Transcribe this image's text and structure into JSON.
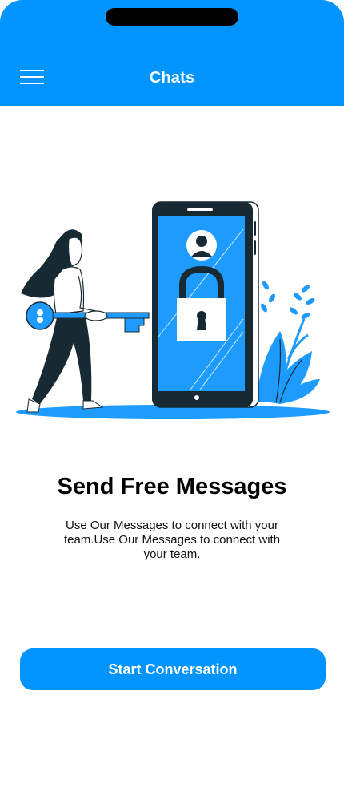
{
  "header": {
    "title": "Chats",
    "menu_icon": "hamburger-menu-icon",
    "background_color": "#0094ff"
  },
  "illustration": {
    "description_icon": "woman-with-key-unlocking-phone-illustration"
  },
  "main": {
    "headline": "Send Free Messages",
    "subtitle": "Use Our Messages to connect with your team.Use Our Messages to connect with your team."
  },
  "cta": {
    "label": "Start Conversation",
    "color": "#0094ff"
  }
}
